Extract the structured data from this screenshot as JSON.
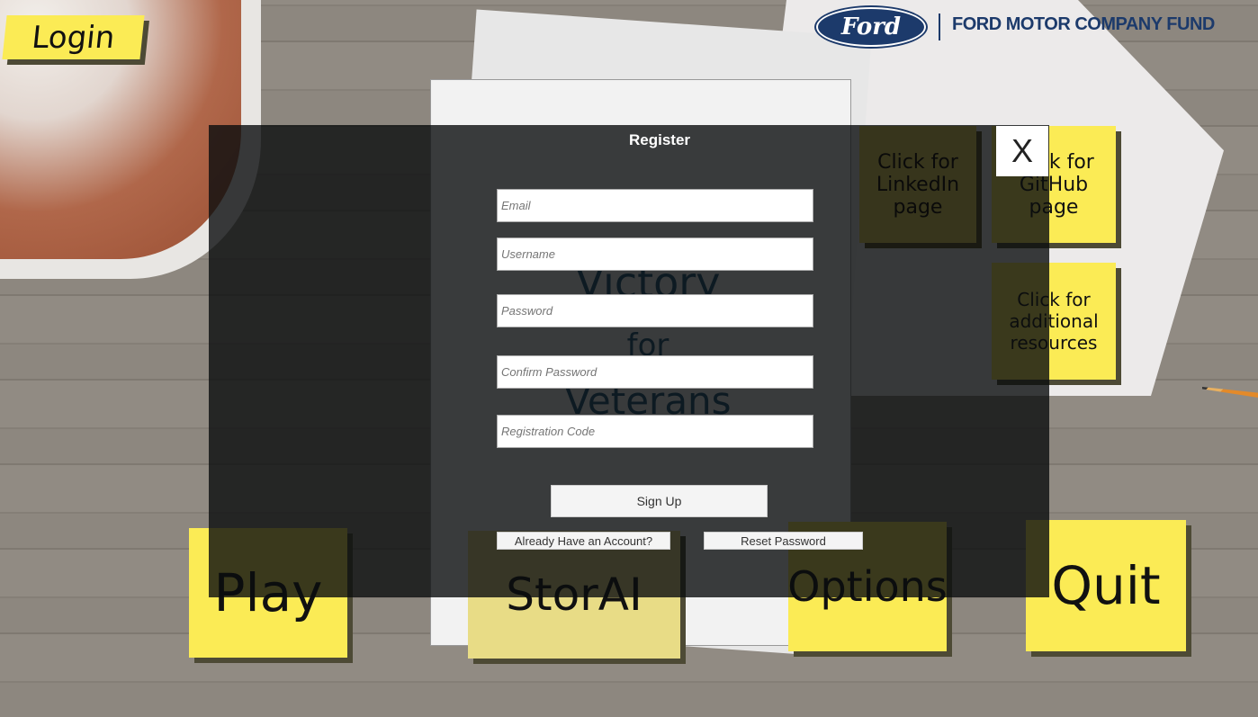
{
  "brand": {
    "logo_text": "Ford",
    "fund_name": "FORD MOTOR COMPANY FUND",
    "color": "#1c3a6b"
  },
  "background": {
    "title_lines": [
      "Victory",
      "for",
      "Veterans"
    ]
  },
  "notes": {
    "login": "Login",
    "play": "Play",
    "storai": "StorAI",
    "options": "Options",
    "quit": "Quit",
    "linkedin": "Click for LinkedIn page",
    "github": "Click for GitHub page",
    "resources": "Click for additional resources"
  },
  "register": {
    "title": "Register",
    "close_label": "X",
    "fields": {
      "email": "Email",
      "username": "Username",
      "password": "Password",
      "confirm_password": "Confirm Password",
      "registration_code": "Registration Code"
    },
    "sign_up": "Sign Up",
    "already_have_account": "Already Have an Account?",
    "reset_password": "Reset Password"
  }
}
